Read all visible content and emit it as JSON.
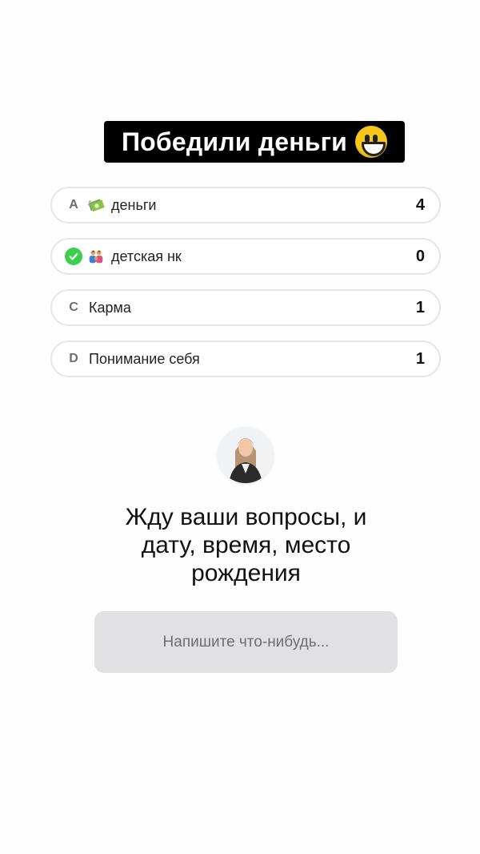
{
  "title": {
    "text": "Победили деньги",
    "emoji": "grinning-face-icon"
  },
  "poll": {
    "options": [
      {
        "marker": "A",
        "icon": "money-icon",
        "label": "деньги",
        "count": "4"
      },
      {
        "marker": "check",
        "icon": "family-icon",
        "label": "детская нк",
        "count": "0"
      },
      {
        "marker": "C",
        "icon": "",
        "label": "Карма",
        "count": "1"
      },
      {
        "marker": "D",
        "icon": "",
        "label": "Понимание себя",
        "count": "1"
      }
    ]
  },
  "question_box": {
    "avatar": "avatar",
    "text": "Жду ваши вопросы, и дату, время, место рождения",
    "placeholder": "Напишите что-нибудь..."
  },
  "colors": {
    "title_bg": "#000000",
    "title_text": "#ffffff",
    "check_green": "#3ccf4e",
    "answer_bg": "#e1e1e3"
  }
}
